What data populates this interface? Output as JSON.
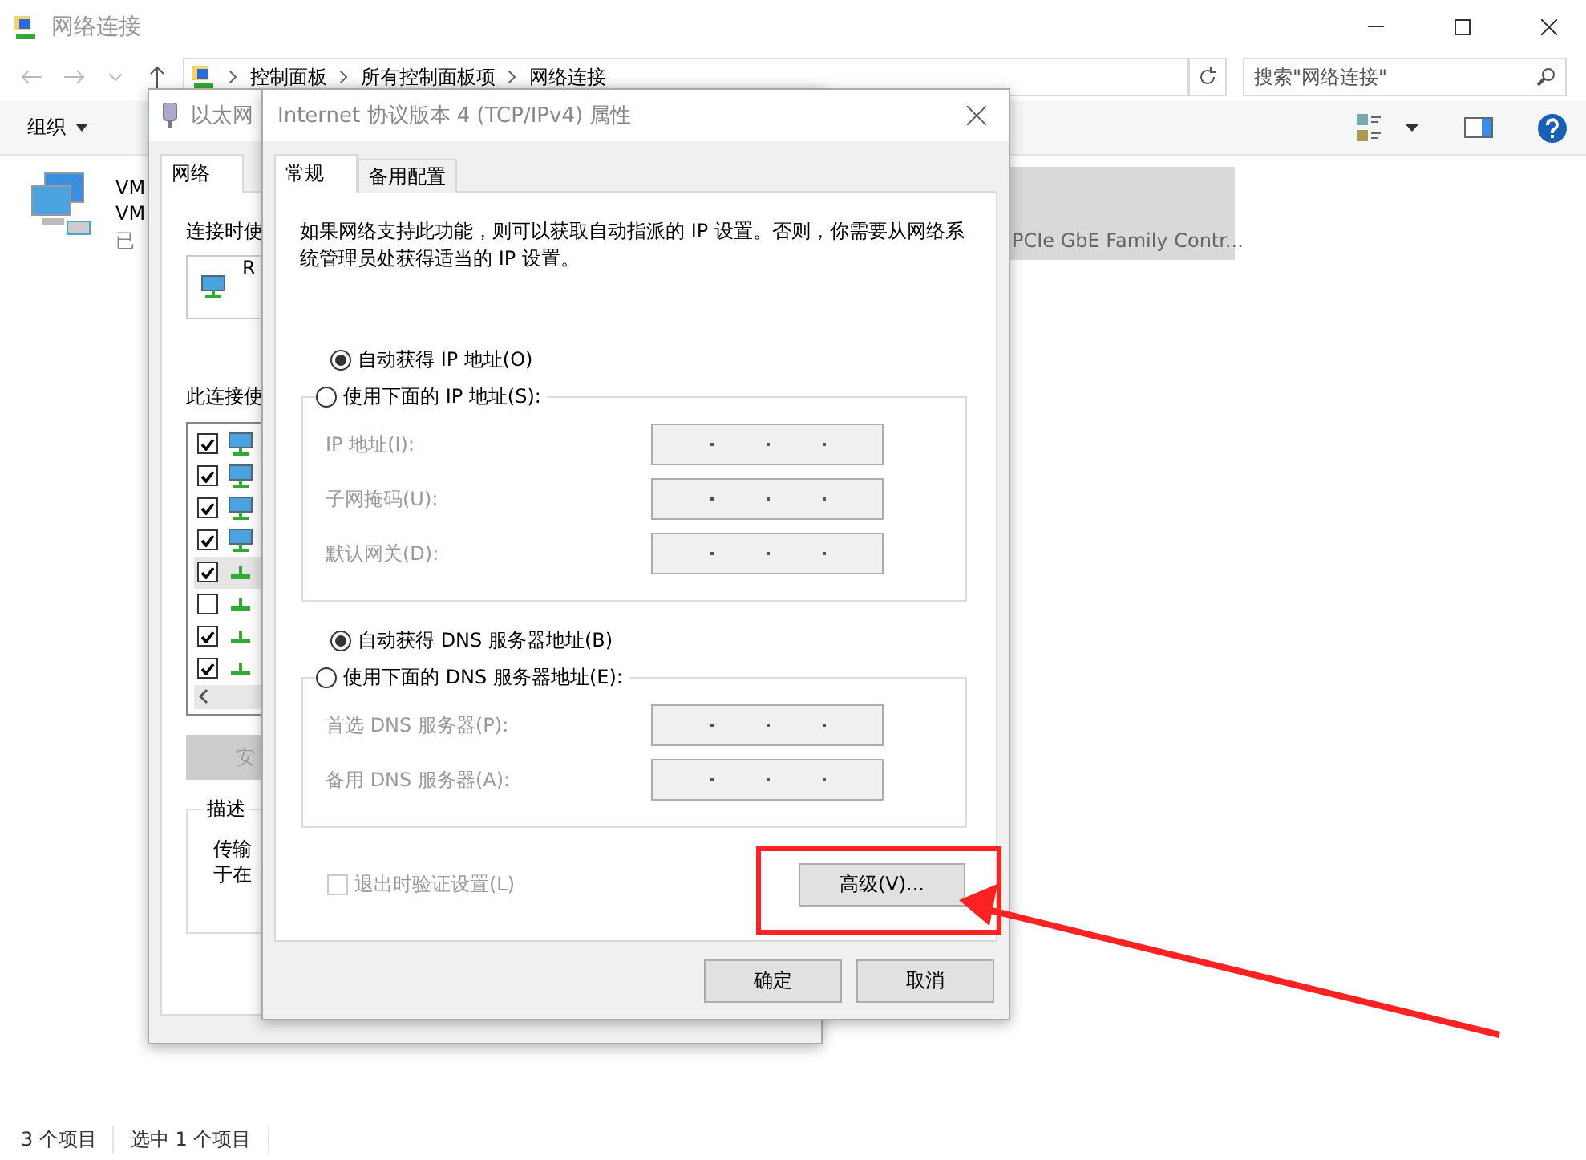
{
  "explorer": {
    "title": "网络连接",
    "breadcrumb": [
      "控制面板",
      "所有控制面板项",
      "网络连接"
    ],
    "search": {
      "placeholder": "搜索\"网络连接\""
    },
    "toolbar": [
      {
        "label": "组织"
      }
    ],
    "items": [
      {
        "name": "VM",
        "detail": "VM",
        "status": "已",
        "selected": false
      },
      {
        "detail": "PCIe GbE Family Contr...",
        "selected": true
      }
    ],
    "status_bar": [
      "3 个项目",
      "选中 1 个项目"
    ]
  },
  "ethernet_dialog": {
    "title": "以太网",
    "tabs": [
      {
        "label": "网络",
        "selected": true
      }
    ],
    "connect_label": "连接时使",
    "adapter": "R",
    "components_label": "此连接使",
    "components": [
      {
        "kind": "computer",
        "checked": true,
        "selected": false
      },
      {
        "kind": "computer",
        "checked": true,
        "selected": false
      },
      {
        "kind": "computer",
        "checked": true,
        "selected": false
      },
      {
        "kind": "computer",
        "checked": true,
        "selected": false
      },
      {
        "kind": "protocol",
        "checked": true,
        "selected": true
      },
      {
        "kind": "protocol",
        "checked": false,
        "selected": false
      },
      {
        "kind": "protocol",
        "checked": true,
        "selected": false
      },
      {
        "kind": "protocol",
        "checked": true,
        "selected": false
      }
    ],
    "install_button": "安",
    "description_title": "描述",
    "description_lines": [
      "传输",
      "于在"
    ]
  },
  "ipv4_dialog": {
    "title": "Internet 协议版本 4 (TCP/IPv4) 属性",
    "tabs": [
      {
        "label": "常规",
        "selected": true
      },
      {
        "label": "备用配置",
        "selected": false
      }
    ],
    "description": "如果网络支持此功能，则可以获取自动指派的 IP 设置。否则，你需要从网络系统管理员处获得适当的 IP 设置。",
    "sections": [
      {
        "auto": {
          "label": "自动获得 IP 地址(O)",
          "selected": true
        },
        "manual": {
          "label": "使用下面的 IP 地址(S):",
          "selected": false
        },
        "fields": [
          {
            "label": "IP 地址(I):",
            "disabled": true
          },
          {
            "label": "子网掩码(U):",
            "disabled": true
          },
          {
            "label": "默认网关(D):",
            "disabled": true
          }
        ]
      },
      {
        "auto": {
          "label": "自动获得 DNS 服务器地址(B)",
          "selected": true
        },
        "manual": {
          "label": "使用下面的 DNS 服务器地址(E):",
          "selected": false
        },
        "fields": [
          {
            "label": "首选 DNS 服务器(P):",
            "disabled": true
          },
          {
            "label": "备用 DNS 服务器(A):",
            "disabled": true
          }
        ]
      }
    ],
    "validate": {
      "label": "退出时验证设置(L)",
      "checked": false,
      "disabled": true
    },
    "advanced_button": "高级(V)...",
    "buttons": [
      "确定",
      "取消"
    ]
  }
}
